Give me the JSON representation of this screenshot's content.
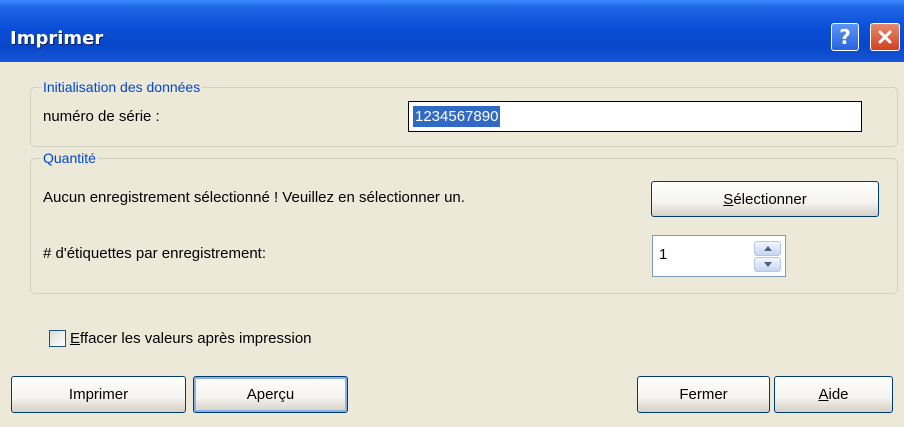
{
  "window": {
    "title": "Imprimer"
  },
  "titlebar": {
    "help_label": "?",
    "help_icon": "help-icon",
    "close_icon": "close-icon"
  },
  "data_init": {
    "legend": "Initialisation des données",
    "serial_label": "numéro de série :",
    "serial_value": "1234567890"
  },
  "quantity": {
    "legend": "Quantité",
    "message": "Aucun enregistrement sélectionné ! Veuillez en sélectionner un.",
    "select_button": {
      "mnemonic": "S",
      "rest": "électionner"
    },
    "labels_per_record_label": "# d'étiquettes par enregistrement:",
    "labels_per_record_value": "1"
  },
  "options": {
    "clear_values": {
      "mnemonic": "E",
      "rest": "ffacer les valeurs après impression",
      "checked": false
    }
  },
  "buttons": {
    "print": "Imprimer",
    "preview": "Aperçu",
    "close": "Fermer",
    "help": {
      "mnemonic": "A",
      "rest": "ide"
    }
  },
  "colors": {
    "titlebar": "#0A4FD8",
    "legend": "#0046D5",
    "dialog_bg": "#ECE9D8",
    "selection": "#316AC5"
  }
}
